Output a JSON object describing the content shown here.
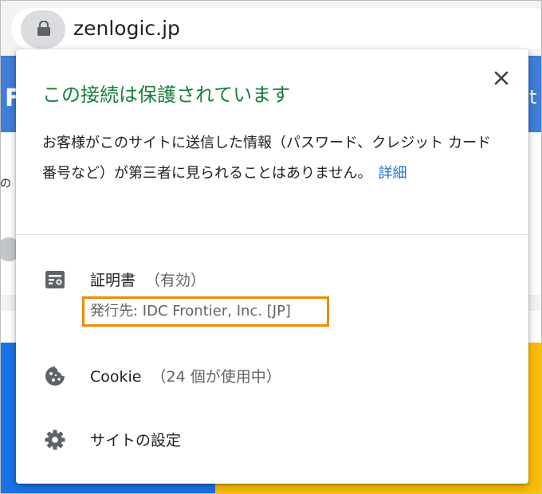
{
  "browser": {
    "url": "zenlogic.jp"
  },
  "background_page": {
    "left_letter": "F",
    "right_letter": "t",
    "left_text": "の"
  },
  "popup": {
    "title": "この接続は保護されています",
    "description": "お客様がこのサイトに送信した情報（パスワード、クレジット カード番号など）が第三者に見られることはありません。",
    "details_link": "詳細",
    "certificate": {
      "label": "証明書",
      "status": "（有効）",
      "issuer": "発行先: IDC Frontier, Inc. [JP]"
    },
    "cookie": {
      "label": "Cookie",
      "status": "（24 個が使用中）"
    },
    "site_settings": {
      "label": "サイトの設定"
    }
  },
  "colors": {
    "title_green": "#188038",
    "link_blue": "#1a73e8",
    "highlight_orange": "#f08a00"
  },
  "icons": [
    "lock-icon",
    "close-icon",
    "certificate-icon",
    "cookie-icon",
    "gear-icon"
  ]
}
